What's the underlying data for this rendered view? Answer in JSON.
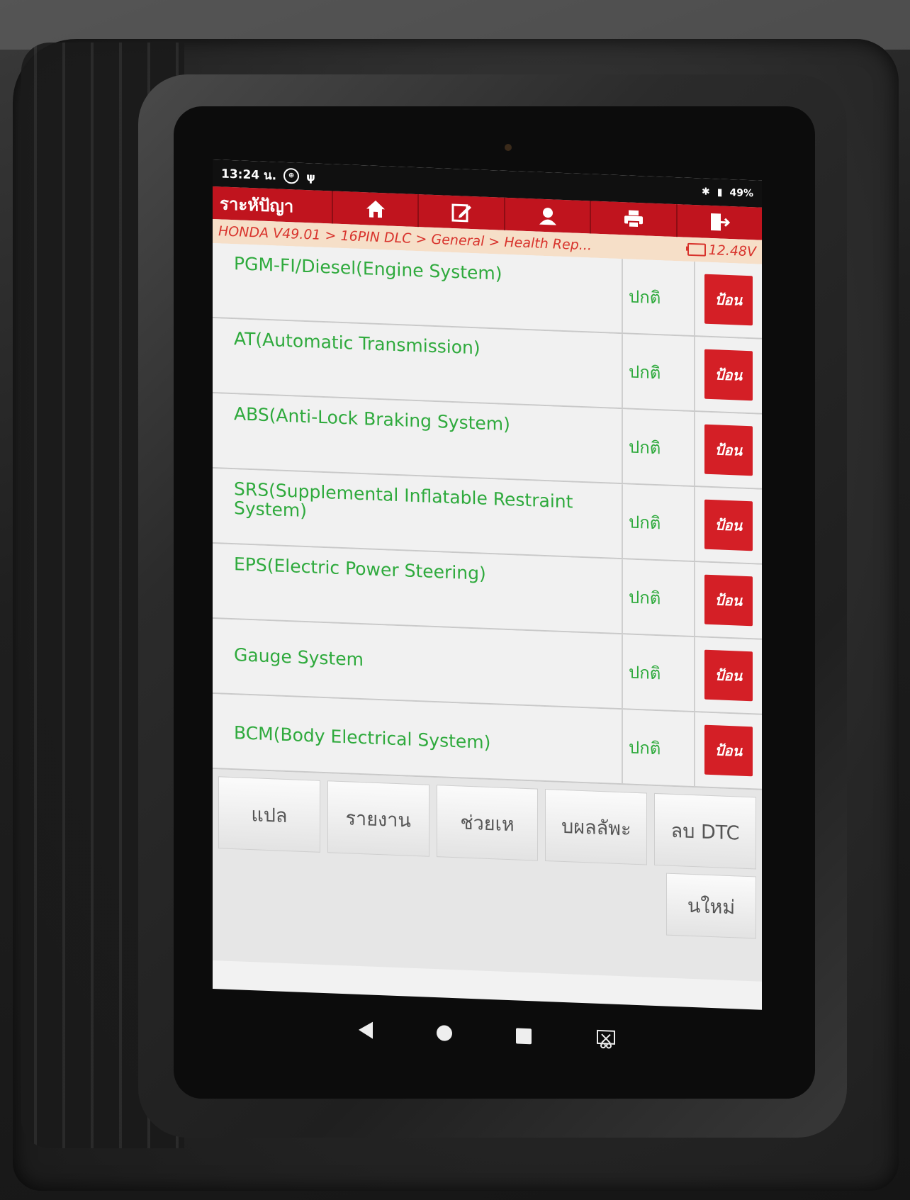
{
  "status_bar": {
    "time": "13:24 น.",
    "battery": "49%"
  },
  "toolbar": {
    "title": "ราะหัปัญา"
  },
  "icons": {
    "home": "home-icon",
    "edit": "edit-icon",
    "user": "user-icon",
    "print": "printer-icon",
    "exit": "exit-icon"
  },
  "breadcrumb": {
    "path": "HONDA V49.01 > 16PIN DLC > General > Health Rep...",
    "voltage": "12.48V"
  },
  "systems": [
    {
      "name": "PGM-FI/Diesel(Engine System)",
      "status": "ปกติ",
      "action": "ป้อน"
    },
    {
      "name": "AT(Automatic Transmission)",
      "status": "ปกติ",
      "action": "ป้อน"
    },
    {
      "name": "ABS(Anti-Lock Braking System)",
      "status": "ปกติ",
      "action": "ป้อน"
    },
    {
      "name": "SRS(Supplemental Inflatable Restraint System)",
      "status": "ปกติ",
      "action": "ป้อน"
    },
    {
      "name": "EPS(Electric Power Steering)",
      "status": "ปกติ",
      "action": "ป้อน"
    },
    {
      "name": "Gauge System",
      "status": "ปกติ",
      "action": "ป้อน"
    },
    {
      "name": "BCM(Body Electrical System)",
      "status": "ปกติ",
      "action": "ป้อน"
    }
  ],
  "functions": {
    "translate": "แปล",
    "report": "รายงาน",
    "help": "ช่วยเห",
    "results": "บผลลัพะ",
    "clear_dtc": "ลบ DTC",
    "new": "นใหม่"
  },
  "colors": {
    "accent": "#c0141e",
    "ok_text": "#2faa3d",
    "breadcrumb_bg": "#f6dfc8"
  }
}
